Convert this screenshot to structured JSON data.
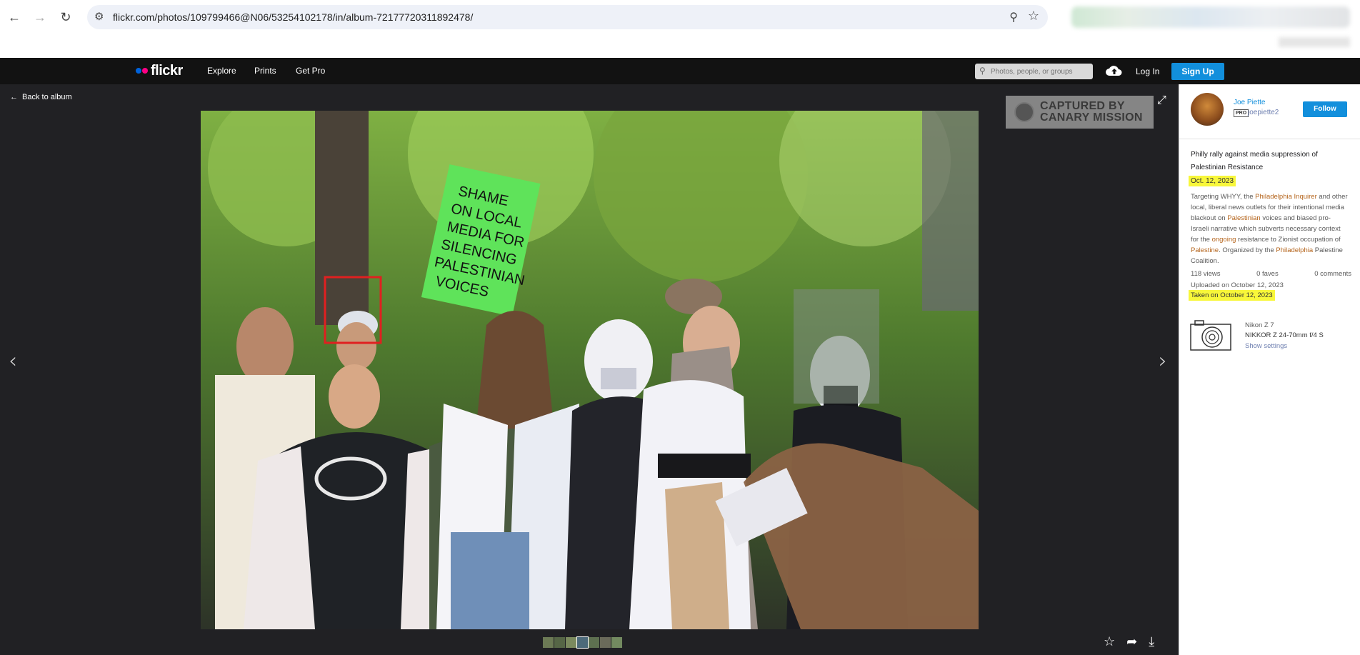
{
  "browser": {
    "url": "flickr.com/photos/109799466@N06/53254102178/in/album-72177720311892478/"
  },
  "header": {
    "logo": "flickr",
    "nav": [
      "Explore",
      "Prints",
      "Get Pro"
    ],
    "search_placeholder": "Photos, people, or groups",
    "login": "Log In",
    "signup": "Sign Up"
  },
  "viewer": {
    "back_label": "Back to album",
    "watermark_line1": "CAPTURED BY",
    "watermark_line2": "CANARY MISSION",
    "sign_text": "SHAME ON LOCAL MEDIA FOR SILENCING PALESTINIAN VOICES"
  },
  "sidebar": {
    "author_name": "Joe Piette",
    "pro_badge": "PRO",
    "author_handle": "joepiette2",
    "follow_label": "Follow",
    "title": "Philly rally against media suppression of Palestinian Resistance",
    "date": "Oct. 12, 2023",
    "description_parts": [
      {
        "t": "Targeting WHYY, the ",
        "link": false
      },
      {
        "t": "Philadelphia",
        "link": true
      },
      {
        "t": " ",
        "link": false
      },
      {
        "t": "Inquirer",
        "link": true
      },
      {
        "t": " and other local, liberal news outlets for their intentional media blackout on ",
        "link": false
      },
      {
        "t": "Palestinian",
        "link": true
      },
      {
        "t": " voices and biased pro- Israeli narrative which subverts necessary context for the ",
        "link": false
      },
      {
        "t": "ongoing",
        "link": true
      },
      {
        "t": " resistance to Zionist occupation of ",
        "link": false
      },
      {
        "t": "Palestine",
        "link": true
      },
      {
        "t": ". Organized by the ",
        "link": false
      },
      {
        "t": "Philadelphia",
        "link": true
      },
      {
        "t": " Palestine Coalition.",
        "link": false
      }
    ],
    "views": "118 views",
    "faves": "0 faves",
    "comments": "0 comments",
    "uploaded": "Uploaded on October 12, 2023",
    "taken": "Taken on October 12, 2023",
    "camera": "Nikon Z 7",
    "lens": "NIKKOR Z 24-70mm f/4 S",
    "show_settings": "Show settings"
  },
  "colors": {
    "brand_blue": "#128fdc",
    "brand_pink": "#ff0084",
    "highlight": "#f8f73a",
    "face_box": "#e02020"
  }
}
